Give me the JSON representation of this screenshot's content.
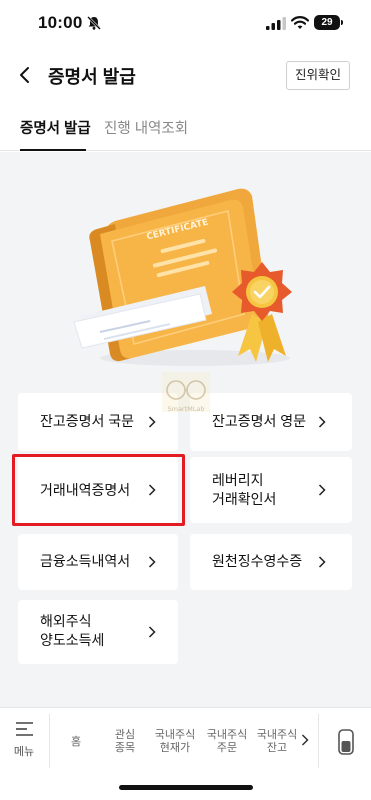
{
  "status_bar": {
    "time": "10:00",
    "battery": "29"
  },
  "header": {
    "title": "증명서 발급",
    "verify_button": "진위확인"
  },
  "tabs": [
    {
      "label": "증명서 발급",
      "active": true
    },
    {
      "label": "진행 내역조회",
      "active": false
    }
  ],
  "illustration": {
    "certificate_text": "CERTIFICATE"
  },
  "watermark": {
    "text": "SmartMLab"
  },
  "certificates": [
    {
      "label": "잔고증명서 국문"
    },
    {
      "label": "잔고증명서 영문"
    },
    {
      "label": "거래내역증명서",
      "highlighted": true
    },
    {
      "label_line1": "레버리지",
      "label_line2": "거래확인서"
    },
    {
      "label": "금융소득내역서"
    },
    {
      "label": "원천징수영수증"
    },
    {
      "label_line1": "해외주식",
      "label_line2": "양도소득세"
    }
  ],
  "bottom_nav": {
    "menu_label": "메뉴",
    "items": [
      {
        "line1": "홈",
        "line2": ""
      },
      {
        "line1": "관심",
        "line2": "종목"
      },
      {
        "line1": "국내주식",
        "line2": "현재가"
      },
      {
        "line1": "국내주식",
        "line2": "주문"
      },
      {
        "line1": "국내주식",
        "line2": "잔고"
      }
    ]
  },
  "colors": {
    "accent_highlight": "#e31b23",
    "certificate_orange": "#f2a33a",
    "content_background": "#f3f4f6"
  }
}
